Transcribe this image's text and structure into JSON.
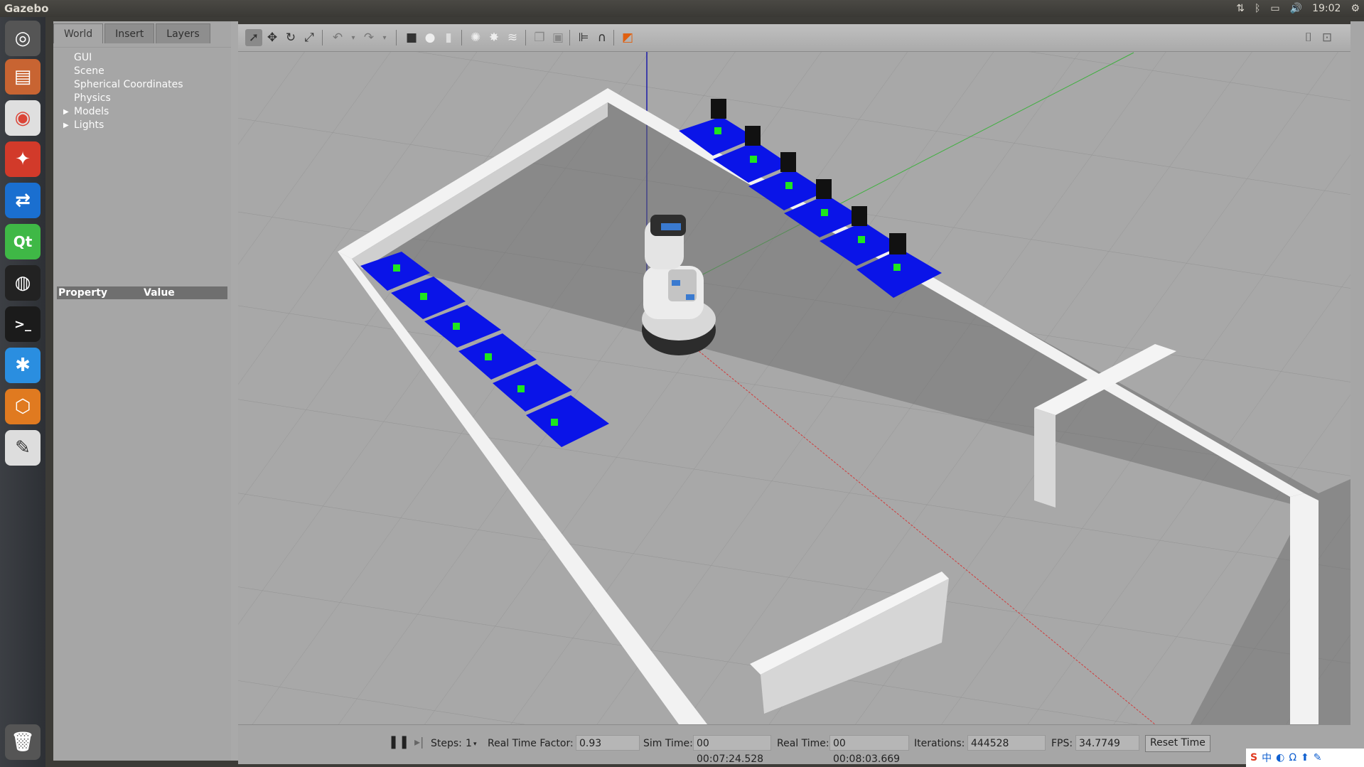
{
  "app": {
    "title": "Gazebo"
  },
  "tray": {
    "clock": "19:02"
  },
  "left_panel": {
    "tabs": [
      "World",
      "Insert",
      "Layers"
    ],
    "tree": [
      "GUI",
      "Scene",
      "Spherical Coordinates",
      "Physics",
      "Models",
      "Lights"
    ],
    "property_header": {
      "property": "Property",
      "value": "Value"
    }
  },
  "toolbar": {
    "icons": [
      "select-mode-icon",
      "translate-mode-icon",
      "rotate-mode-icon",
      "scale-mode-icon",
      "undo-icon",
      "undo-history-icon",
      "redo-icon",
      "redo-history-icon",
      "box-icon",
      "sphere-icon",
      "cylinder-icon",
      "point-light-icon",
      "spot-light-icon",
      "directional-light-icon",
      "copy-icon",
      "paste-icon",
      "align-icon",
      "snap-icon",
      "view-angle-icon",
      "screenshot-icon",
      "log-icon"
    ]
  },
  "bottom": {
    "steps_label": "Steps:",
    "steps_value": "1",
    "rtf_label": "Real Time Factor:",
    "rtf_value": "0.93",
    "sim_time_label": "Sim Time:",
    "sim_time_value": "00 00:07:24.528",
    "real_time_label": "Real Time:",
    "real_time_value": "00 00:08:03.669",
    "iterations_label": "Iterations:",
    "iterations_value": "444528",
    "fps_label": "FPS:",
    "fps_value": "34.7749",
    "reset_label": "Reset Time"
  },
  "colors": {
    "ground": "#a8a8a8",
    "wall": "#f4f4f4",
    "table": "#0a14e8",
    "cube": "#1ee61e"
  }
}
